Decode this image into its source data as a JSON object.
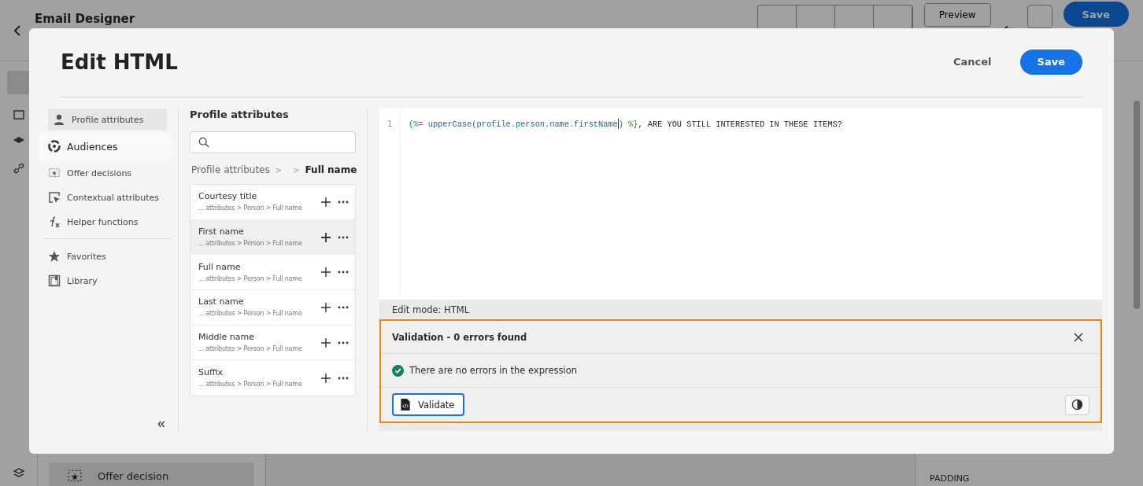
{
  "background": {
    "app_title": "Email Designer",
    "preview_button": "Preview",
    "save_button": "Save",
    "panel_item": "Offer decision",
    "section_label": "PADDING"
  },
  "dialog": {
    "title": "Edit HTML",
    "cancel": "Cancel",
    "save": "Save",
    "nav": [
      [
        {
          "label": "Profile attributes",
          "selected": true,
          "hovered": false
        },
        {
          "label": "Audiences",
          "selected": false,
          "hovered": true
        },
        {
          "label": "Offer decisions",
          "selected": false,
          "hovered": false
        },
        {
          "label": "Contextual attributes",
          "selected": false,
          "hovered": false
        },
        {
          "label": "Helper functions",
          "selected": false,
          "hovered": false
        }
      ],
      [
        {
          "label": "Favorites",
          "selected": false,
          "hovered": false
        },
        {
          "label": "Library",
          "selected": false,
          "hovered": false
        }
      ]
    ],
    "collapse": "«",
    "attributes": {
      "heading": "Profile attributes",
      "breadcrumb": {
        "root": "Profile attributes",
        "separator": ">",
        "current": "Full name"
      },
      "items": [
        {
          "name": "Courtesy title",
          "path": "... attributes > Person > Full name",
          "hovered": false
        },
        {
          "name": "First name",
          "path": "... attributes > Person > Full name",
          "hovered": true
        },
        {
          "name": "Full name",
          "path": "... attributes > Person > Full name",
          "hovered": false
        },
        {
          "name": "Last name",
          "path": "... attributes > Person > Full name",
          "hovered": false
        },
        {
          "name": "Middle name",
          "path": "... attributes > Person > Full name",
          "hovered": false
        },
        {
          "name": "Suffix",
          "path": "... attributes > Person > Full name",
          "hovered": false
        }
      ]
    },
    "editor": {
      "line_number": "1",
      "tokens": [
        {
          "kind": "delim",
          "text": "{%"
        },
        {
          "kind": "op",
          "text": "="
        },
        {
          "kind": "func",
          "text": " upperCase(profile.person.name.firstName"
        },
        {
          "kind": "cursor"
        },
        {
          "kind": "func",
          "text": ") "
        },
        {
          "kind": "delim",
          "text": "%}"
        },
        {
          "kind": "plain",
          "text": ", ARE YOU STILL INTERESTED IN THESE ITEMS?"
        }
      ],
      "mode": "Edit mode: HTML"
    },
    "validation": {
      "title": "Validation - 0 errors found",
      "message": "There are no errors in the expression",
      "validate_button": "Validate"
    }
  }
}
